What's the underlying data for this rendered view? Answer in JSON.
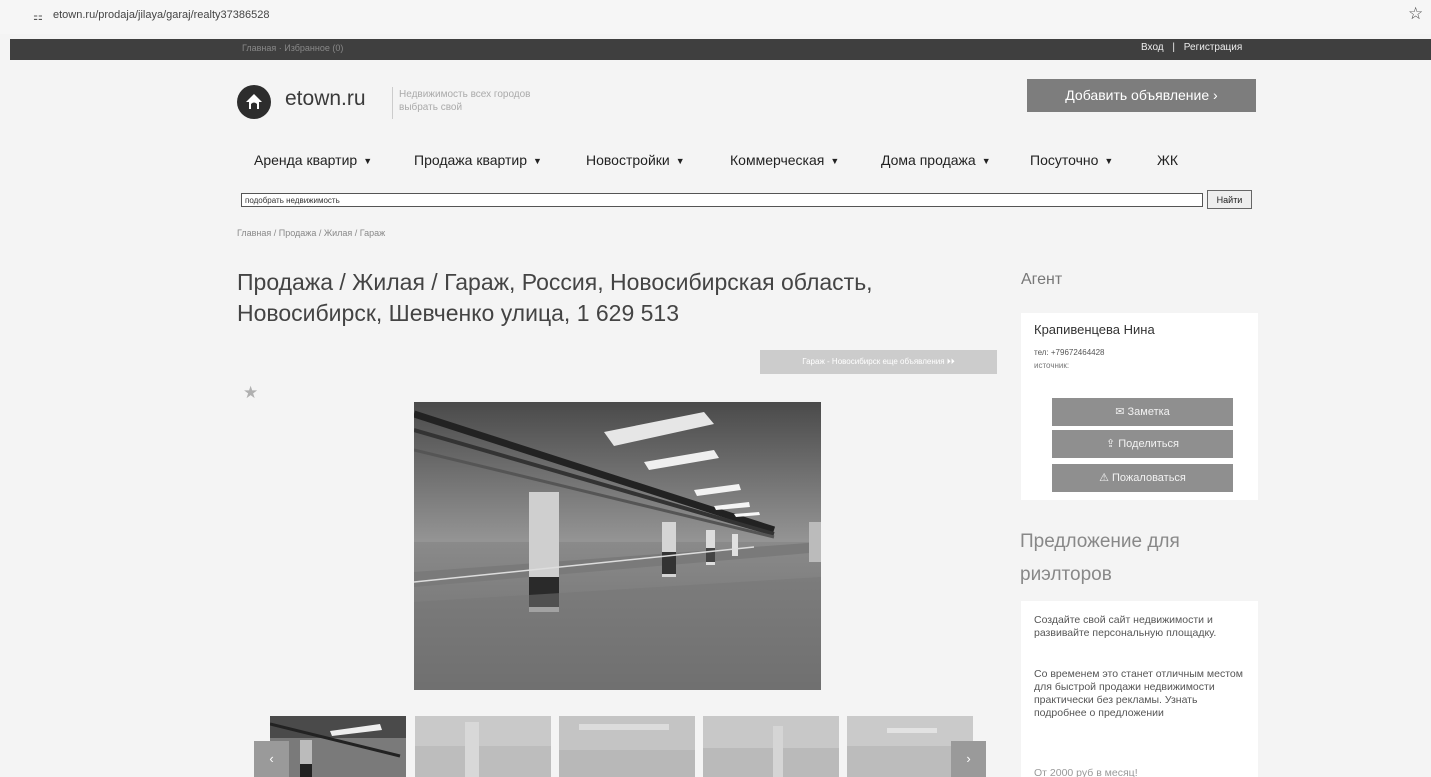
{
  "browser": {
    "url": "etown.ru/prodaja/jilaya/garaj/realty37386528"
  },
  "topbar": {
    "left_links": "Главная · Избранное (0)",
    "login": "Вход",
    "separator": "|",
    "register": "Регистрация"
  },
  "header": {
    "logo_text": "etown.ru",
    "tagline": "Недвижимость всех городов выбрать свой",
    "add_button": "Добавить объявление ›"
  },
  "nav": {
    "items": [
      {
        "label": "Аренда квартир"
      },
      {
        "label": "Продажа квартир"
      },
      {
        "label": "Новостройки"
      },
      {
        "label": "Коммерческая"
      },
      {
        "label": "Дома продажа"
      },
      {
        "label": "Посуточно"
      },
      {
        "label": "ЖК"
      }
    ]
  },
  "search": {
    "value": "подобрать недвижимость",
    "button": "Найти"
  },
  "breadcrumb": "Главная / Продажа / Жилая / Гараж",
  "listing": {
    "title": "Продажа / Жилая / Гараж, Россия, Новосибирская область, Новосибирск, Шевченко улица, 1 629 513",
    "more_button": "Гараж - Новосибирск еще объявления ⏵⏵"
  },
  "agent": {
    "heading": "Агент",
    "name": "Крапивенцева Нина",
    "tel": "тел: +79672464428",
    "source": "источник:",
    "buttons": {
      "note": "✉ Заметка",
      "share": "⇪ Поделиться",
      "complain": "⚠ Пожаловаться"
    }
  },
  "offer": {
    "heading": "Предложение для риэлторов",
    "p1": "Создайте свой сайт недвижимости и развивайте персональную площадку.",
    "p2": "Со временем это станет отличным местом для быстрой продажи недвижимости практически без рекламы. Узнать подробнее о предложении",
    "p3": "От 2000 руб в месяц!"
  },
  "gallery": {
    "prev": "‹",
    "next": "›"
  }
}
